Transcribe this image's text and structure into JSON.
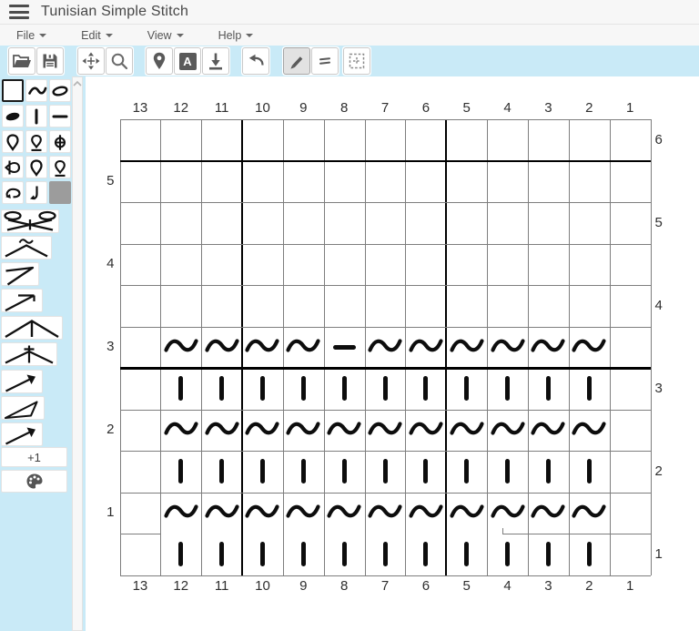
{
  "app": {
    "title": "Tunisian Simple Stitch"
  },
  "colors": {
    "accent_blue": "#c9eaf7",
    "bar_background": "#f7f7f7",
    "symbol_black": "#0d0d0d",
    "grid_line": "#7e7e7e",
    "no_stitch_gray": "#9c9c9c"
  },
  "menus": [
    {
      "label": "File"
    },
    {
      "label": "Edit"
    },
    {
      "label": "View"
    },
    {
      "label": "Help"
    }
  ],
  "toolbar": {
    "a_label": "A",
    "groups": [
      {
        "buttons": [
          {
            "icon": "open-folder"
          },
          {
            "icon": "save"
          }
        ]
      },
      {
        "buttons": [
          {
            "icon": "move"
          },
          {
            "icon": "zoom-search"
          }
        ]
      },
      {
        "buttons": [
          {
            "icon": "location-pin"
          },
          {
            "icon": "text-a"
          },
          {
            "icon": "download"
          }
        ]
      },
      {
        "buttons": [
          {
            "icon": "undo"
          }
        ]
      },
      {
        "buttons": [
          {
            "icon": "pencil",
            "active": true
          },
          {
            "icon": "equals"
          }
        ]
      },
      {
        "buttons": [
          {
            "icon": "grid-select"
          }
        ]
      }
    ]
  },
  "palette": {
    "small_items": [
      {
        "symbol": "blank",
        "selected": true
      },
      {
        "symbol": "tilde"
      },
      {
        "symbol": "oval-outline"
      },
      {
        "symbol": "oval-filled"
      },
      {
        "symbol": "vbar"
      },
      {
        "symbol": "hbar"
      },
      {
        "symbol": "loop"
      },
      {
        "symbol": "loop-underline"
      },
      {
        "symbol": "phi-cross"
      },
      {
        "symbol": "loop-side"
      },
      {
        "symbol": "loop"
      },
      {
        "symbol": "loop-underline"
      },
      {
        "symbol": "hook-left"
      },
      {
        "symbol": "hook-down"
      },
      {
        "symbol": "gray-square"
      }
    ],
    "wide_items": [
      {
        "symbol": "cluster-bowtie",
        "width": 64
      },
      {
        "symbol": "tilde-chevron",
        "width": 56
      },
      {
        "symbol": "angle-seven",
        "width": 42
      },
      {
        "symbol": "diag-flag",
        "width": 46
      },
      {
        "symbol": "chevron-line",
        "width": 68
      },
      {
        "symbol": "chevron-cross",
        "width": 62
      },
      {
        "symbol": "arrow-up-right",
        "width": 46
      },
      {
        "symbol": "triangle-open",
        "width": 48
      },
      {
        "symbol": "arrow-up-right",
        "width": 46
      }
    ],
    "add_label": "+1",
    "palette_icon": "color-palette"
  },
  "chart_data": {
    "type": "stitch-grid",
    "title": "Tunisian Simple Stitch",
    "columns_top": [
      "13",
      "12",
      "11",
      "10",
      "9",
      "8",
      "7",
      "6",
      "5",
      "4",
      "3",
      "2",
      "1"
    ],
    "columns_bottom": [
      "13",
      "12",
      "11",
      "10",
      "9",
      "8",
      "7",
      "6",
      "5",
      "4",
      "3",
      "2",
      "1"
    ],
    "left_row_labels": [
      {
        "row": 2,
        "label": "5"
      },
      {
        "row": 4,
        "label": "4"
      },
      {
        "row": 6,
        "label": "3"
      },
      {
        "row": 8,
        "label": "2"
      },
      {
        "row": 10,
        "label": "1"
      }
    ],
    "right_row_labels": [
      {
        "row": 1,
        "label": "6"
      },
      {
        "row": 3,
        "label": "5"
      },
      {
        "row": 5,
        "label": "4"
      },
      {
        "row": 7,
        "label": "3"
      },
      {
        "row": 9,
        "label": "2"
      },
      {
        "row": 11,
        "label": "1"
      }
    ],
    "heavy_vertical_boundaries": [
      3,
      8
    ],
    "heavy_horizontal_boundaries": [
      1,
      6
    ],
    "partial_horizontal_boundary_row": 10,
    "rows": [
      [
        "",
        "",
        "",
        "",
        "",
        "",
        "",
        "",
        "",
        "",
        "",
        "",
        ""
      ],
      [
        "",
        "",
        "",
        "",
        "",
        "",
        "",
        "",
        "",
        "",
        "",
        "",
        ""
      ],
      [
        "",
        "",
        "",
        "",
        "",
        "",
        "",
        "",
        "",
        "",
        "",
        "",
        ""
      ],
      [
        "",
        "",
        "",
        "",
        "",
        "",
        "",
        "",
        "",
        "",
        "",
        "",
        ""
      ],
      [
        "",
        "",
        "",
        "",
        "",
        "",
        "",
        "",
        "",
        "",
        "",
        "",
        ""
      ],
      [
        "",
        "~",
        "~",
        "~",
        "~",
        "-",
        "~",
        "~",
        "~",
        "~",
        "~",
        "~",
        ""
      ],
      [
        "",
        "|",
        "|",
        "|",
        "|",
        "|",
        "|",
        "|",
        "|",
        "|",
        "|",
        "|",
        ""
      ],
      [
        "",
        "~",
        "~",
        "~",
        "~",
        "~",
        "~",
        "~",
        "~",
        "~",
        "~",
        "~",
        ""
      ],
      [
        "",
        "|",
        "|",
        "|",
        "|",
        "|",
        "|",
        "|",
        "|",
        "|",
        "|",
        "|",
        ""
      ],
      [
        "",
        "~",
        "~",
        "~",
        "~",
        "~",
        "~",
        "~",
        "~",
        "~",
        "~",
        "~",
        ""
      ],
      [
        "",
        "|",
        "|",
        "|",
        "|",
        "|",
        "|",
        "|",
        "|",
        "|",
        "|",
        "|",
        ""
      ]
    ]
  }
}
